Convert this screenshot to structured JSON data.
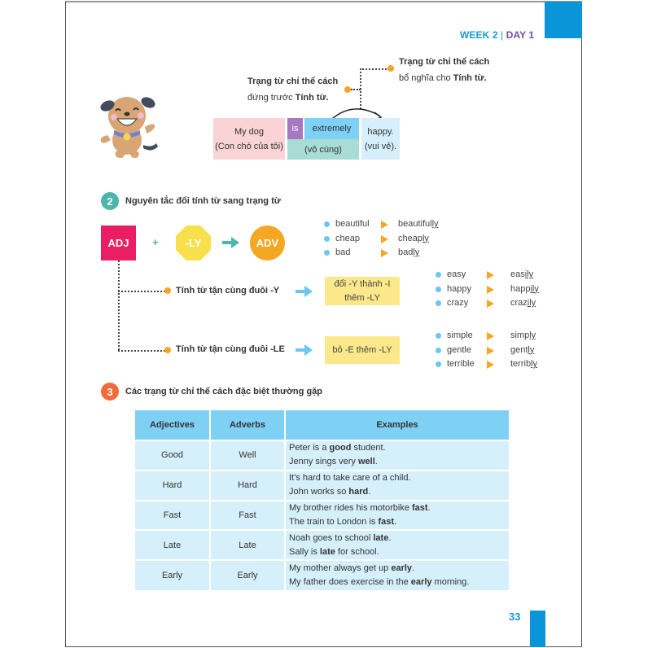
{
  "header": {
    "week": "WEEK 2",
    "separator": "|",
    "day": "DAY 1"
  },
  "section1": {
    "note_left": {
      "line1": "Trạng từ chỉ thể cách",
      "line2_prefix": "đứng trước ",
      "line2_bold": "Tính từ."
    },
    "note_right": {
      "line1": "Trạng từ chỉ thể cách",
      "line2_prefix": "bổ nghĩa cho ",
      "line2_bold": "Tính từ."
    },
    "sentence": {
      "subject": "My dog",
      "subject_vi": "(Con chó của tôi)",
      "verb": "is",
      "adverb": "extremely",
      "adverb_vi": "(vô cùng)",
      "adjective": "happy.",
      "adjective_vi": "(vui vẻ)."
    },
    "colors": {
      "subject_bg": "#f9d3d6",
      "verb_bg": "#a678c0",
      "adverb_bg": "#7fd0f5",
      "adverb_vi_bg": "#a8dcd5",
      "adjective_bg": "#d6f0fb"
    }
  },
  "section2": {
    "number": "2",
    "title": "Nguyên tắc đổi tính từ sang trạng từ",
    "formula": {
      "adj": "ADJ",
      "plus": "+",
      "ly": "-LY",
      "adv": "ADV"
    },
    "examples": [
      {
        "base": "beautiful",
        "stem": "beautiful",
        "suffix": "ly"
      },
      {
        "base": "cheap",
        "stem": "cheap",
        "suffix": "ly"
      },
      {
        "base": "bad",
        "stem": "bad",
        "suffix": "ly"
      }
    ],
    "rules": [
      {
        "label": "Tính từ tận cùng đuôi -Y",
        "action_line1": "đổi -Y thành -I",
        "action_line2": "thêm -LY",
        "examples": [
          {
            "base": "easy",
            "stem": "eas",
            "suffix": "ily"
          },
          {
            "base": "happy",
            "stem": "happ",
            "suffix": "ily"
          },
          {
            "base": "crazy",
            "stem": "craz",
            "suffix": "ily"
          }
        ]
      },
      {
        "label": "Tính từ tận cùng đuôi -LE",
        "action_line1": "bỏ -E thêm -LY",
        "action_line2": "",
        "examples": [
          {
            "base": "simple",
            "stem": "simp",
            "suffix": "ly"
          },
          {
            "base": "gentle",
            "stem": "gent",
            "suffix": "ly"
          },
          {
            "base": "terrible",
            "stem": "terrib",
            "suffix": "ly"
          }
        ]
      }
    ]
  },
  "section3": {
    "number": "3",
    "title": "Các trạng từ chỉ thể cách đặc biệt thường gặp",
    "table": {
      "headers": [
        "Adjectives",
        "Adverbs",
        "Examples"
      ],
      "rows": [
        {
          "adj": "Good",
          "adv": "Well",
          "ex1": [
            "Peter is a ",
            "good",
            " student."
          ],
          "ex2": [
            "Jenny sings very ",
            "well",
            "."
          ]
        },
        {
          "adj": "Hard",
          "adv": "Hard",
          "ex1": [
            "It’s hard to take care of a child.",
            "",
            ""
          ],
          "ex2": [
            "John works so ",
            "hard",
            "."
          ]
        },
        {
          "adj": "Fast",
          "adv": "Fast",
          "ex1": [
            "My brother rides his motorbike ",
            "fast",
            "."
          ],
          "ex2": [
            "The train to London is ",
            "fast",
            "."
          ]
        },
        {
          "adj": "Late",
          "adv": "Late",
          "ex1": [
            "Noah goes to school ",
            "late",
            "."
          ],
          "ex2": [
            "Sally is ",
            "late",
            " for school."
          ]
        },
        {
          "adj": "Early",
          "adv": "Early",
          "ex1": [
            "My mother always get up ",
            "early",
            "."
          ],
          "ex2": [
            "My father does exercise in the ",
            "early",
            " morning."
          ]
        }
      ]
    }
  },
  "footer": {
    "page_number": "33"
  },
  "theme": {
    "brand_blue": "#0a95d8",
    "purple": "#7a4ba0",
    "orange": "#f5a623",
    "pink": "#e91e63",
    "yellow": "#f7e04b",
    "teal": "#4db6ac",
    "section3_badge": "#f26b3a"
  }
}
